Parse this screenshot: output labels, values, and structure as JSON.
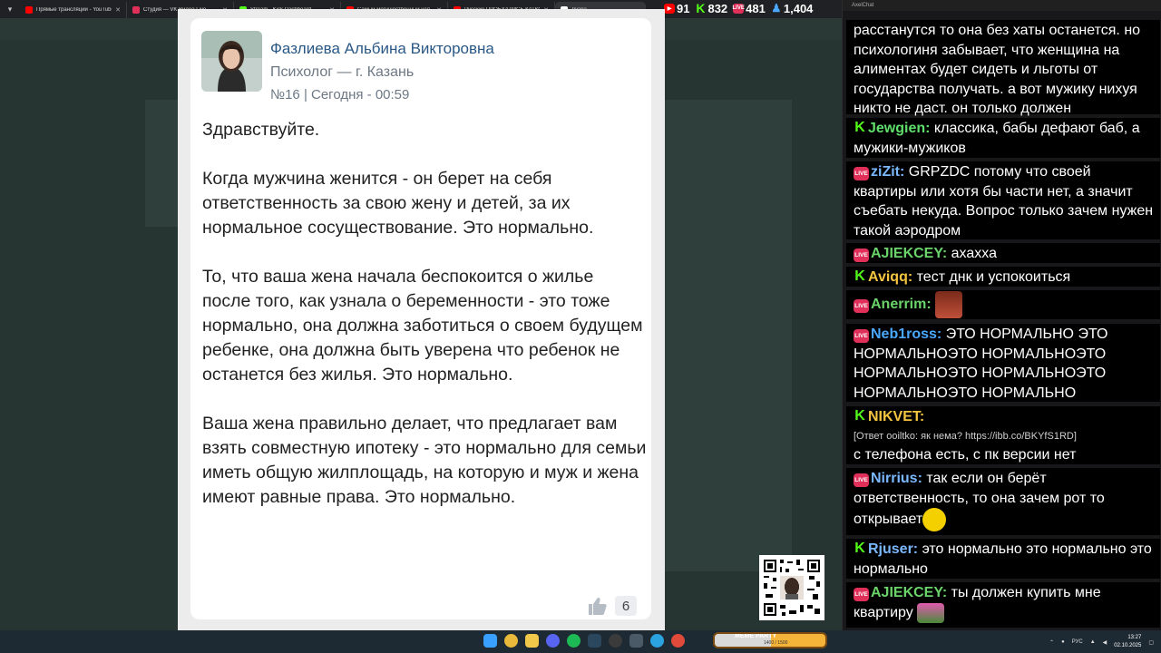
{
  "browser": {
    "tabs": [
      {
        "title": "Прямые трансляции - YouTube",
        "color": "#ff0000"
      },
      {
        "title": "Студия — VK Видео Live",
        "color": "#e0305a"
      },
      {
        "title": "Stream - Kick Dashboard",
        "color": "#53fc18"
      },
      {
        "title": "Самый могущественный чел...",
        "color": "#ff0000"
      },
      {
        "title": "Русские ПРОЕХАЛИСЬ КАТКОЙ...",
        "color": "#ff0000"
      },
      {
        "title": "Дуэра",
        "color": "#ffffff"
      }
    ]
  },
  "counters": [
    {
      "platform": "youtube",
      "value": "91",
      "color": "#ff0000"
    },
    {
      "platform": "kick",
      "value": "832",
      "color": "#53fc18"
    },
    {
      "platform": "vk",
      "value": "481",
      "color": "#e0305a",
      "badge": "LIVE"
    },
    {
      "platform": "viewers",
      "value": "1,404",
      "color": "#4aa8ff"
    }
  ],
  "card": {
    "author_name": "Фазлиева Альбина Викторовна",
    "author_role": "Психолог — г. Казань",
    "author_meta": "№16 | Сегодня - 00:59",
    "paragraphs": [
      "Здравствуйте.",
      "Когда мужчина женится - он берет на себя ответственность за свою жену и детей, за их нормальное сосуществование. Это нормально.",
      "То, что ваша жена начала беспокоится о жилье после того, как узнала о беременности - это тоже нормально, она должна заботиться о своем будущем ребенке, она должна быть уверена что ребенок не останется без жилья. Это нормально.",
      "Ваша жена правильно делает, что предлагает вам взять совместную ипотеку - это нормально для семьи иметь общую жилплощадь, на которую и муж и жена имеют равные права. Это нормально."
    ],
    "likes": "6"
  },
  "chat": {
    "window_title": "AxelChat",
    "messages": [
      {
        "platform": "none",
        "user": "",
        "user_color": "#fff",
        "text": "расстанутся то она без хаты останется. но психологиня забывает, что женщина на алиментах будет сидеть и льготы от государства получать. а вот мужику нихуя никто не даст. он только должен"
      },
      {
        "platform": "kick",
        "user": "Jewgien:",
        "user_color": "#5fe06a",
        "text": "классика, бабы дефают баб, а мужики-мужиков"
      },
      {
        "platform": "vk",
        "user": "ziZit:",
        "user_color": "#7ab8ff",
        "text": "GRPZDC потому что своей квартиры или хотя бы части нет, а значит съебать некуда. Вопрос только зачем нужен такой аэродром",
        "text_bold": "GRPZDC"
      },
      {
        "platform": "vk",
        "user": "AJIEKCEY:",
        "user_color": "#6ad46a",
        "text": "ахахха"
      },
      {
        "platform": "kick",
        "user": "Aviqq:",
        "user_color": "#f5c542",
        "text": "тест днк и успокоиться"
      },
      {
        "platform": "vk",
        "user": "Anerrim:",
        "user_color": "#6ad46a",
        "text": ""
      },
      {
        "platform": "vk",
        "user": "Neb1ross:",
        "user_color": "#4aa8ff",
        "text": "ЭТО НОРМАЛЬНО ЭТО НОРМАЛЬНОЭТО НОРМАЛЬНОЭТО НОРМАЛЬНОЭТО НОРМАЛЬНОЭТО НОРМАЛЬНОЭТО НОРМАЛЬНО"
      },
      {
        "platform": "kick",
        "user": "NIKVET:",
        "user_color": "#f5c542",
        "reply": "[Ответ ooiltko: як нема? https://ibb.co/BKYfS1RD]",
        "text": "с телефона есть, с пк версии нет"
      },
      {
        "platform": "vk",
        "user": "Nirrius:",
        "user_color": "#7ab8ff",
        "text": "так если он берёт ответственность, то она зачем рот то открывает"
      },
      {
        "platform": "kick",
        "user": "Rjuser:",
        "user_color": "#7ab8ff",
        "text": "это нормально это нормально это нормально"
      },
      {
        "platform": "vk",
        "user": "AJIEKCEY:",
        "user_color": "#6ad46a",
        "text": "ты должен купить мне квартиру"
      }
    ]
  },
  "taskbar": {
    "meme_title": "MEME PARTY",
    "meme_progress": "1400 / 1500",
    "meme_fraction": 0.93,
    "lang": "РУС",
    "time": "13:27",
    "date": "02.10.2025"
  }
}
